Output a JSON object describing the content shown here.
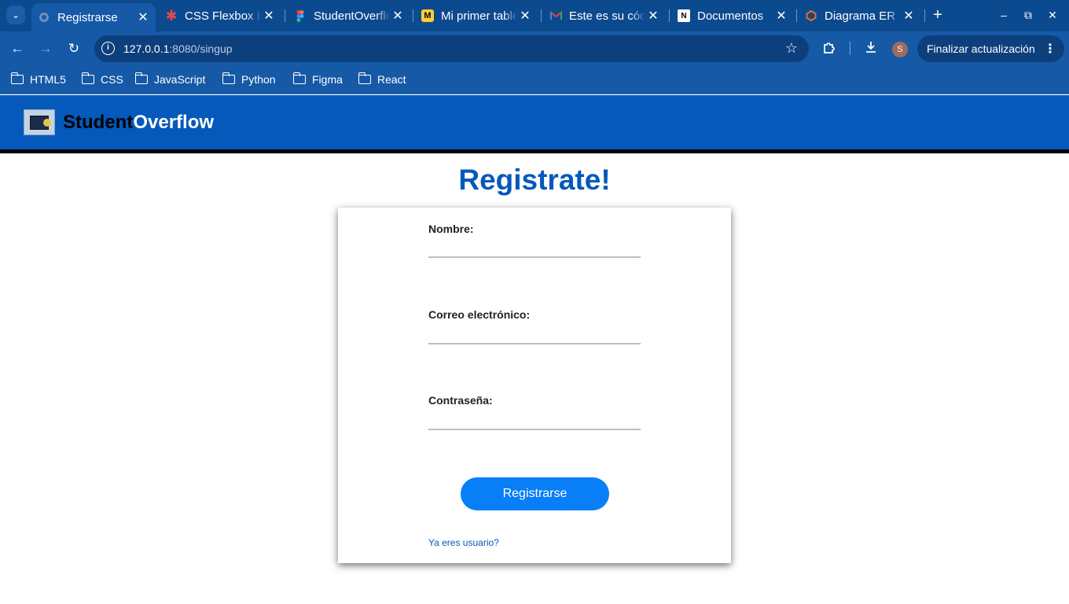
{
  "browser": {
    "tabs": [
      {
        "title": "Registrarse",
        "icon": "globe-icon",
        "active": true
      },
      {
        "title": "CSS Flexbox Layout",
        "icon": "asterisk-icon",
        "active": false
      },
      {
        "title": "StudentOverflow",
        "icon": "figma-icon",
        "active": false
      },
      {
        "title": "Mi primer tablero",
        "icon": "miro-icon",
        "active": false
      },
      {
        "title": "Este es su código",
        "icon": "gmail-icon",
        "active": false
      },
      {
        "title": "Documentos",
        "icon": "notion-icon",
        "active": false
      },
      {
        "title": "Diagrama ER",
        "icon": "diagram-icon",
        "active": false
      }
    ],
    "url_host": "127.0.0.1",
    "url_path": ":8080/singup",
    "update_label": "Finalizar actualización",
    "avatar_letter": "S",
    "bookmarks": [
      "HTML5",
      "CSS",
      "JavaScript",
      "Python",
      "Figma",
      "React"
    ]
  },
  "site": {
    "brand_part1": "Student",
    "brand_part2": "Overflow",
    "header_color": "#0459bb"
  },
  "signup": {
    "title": "Registrate!",
    "name_label": "Nombre:",
    "name_value": "",
    "email_label": "Correo electrónico:",
    "email_value": "",
    "password_label": "Contraseña:",
    "password_value": "",
    "submit_label": "Registrarse",
    "login_link": "Ya eres usuario?",
    "accent_color": "#087ef7"
  }
}
